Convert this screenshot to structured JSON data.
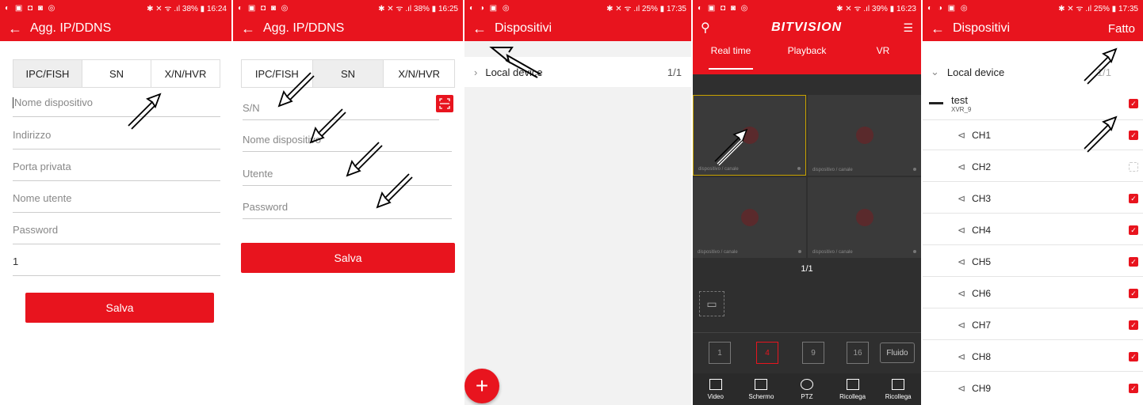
{
  "colors": {
    "accent": "#e8141e",
    "dark": "#333333"
  },
  "panel1": {
    "status_left": "◐ ▣ ◘ ◙ ◎",
    "status_right": "✱ ✕ ᯤ .ıl 38% ▮ 16:24",
    "title": "Agg. IP/DDNS",
    "tabs": [
      "IPC/FISH",
      "SN",
      "X/N/HVR"
    ],
    "fields": {
      "device_name": "Nome dispositivo",
      "address": "Indirizzo",
      "private_port": "Porta privata",
      "username": "Nome utente",
      "password": "Password",
      "channels_value": "1"
    },
    "save": "Salva"
  },
  "panel2": {
    "status_left": "◐ ▣ ◘ ◙ ◎",
    "status_right": "✱ ✕ ᯤ .ıl 38% ▮ 16:25",
    "title": "Agg. IP/DDNS",
    "tabs": [
      "IPC/FISH",
      "SN",
      "X/N/HVR"
    ],
    "fields": {
      "sn": "S/N",
      "device_name": "Nome dispositivo",
      "user": "Utente",
      "password": "Password"
    },
    "save": "Salva"
  },
  "panel3": {
    "status_left": "◐ ◑ ▣ ◎",
    "status_right": "✱ ✕ ᯤ .ıl 25% ▮ 17:35",
    "title": "Dispositivi",
    "row_label": "Local device",
    "row_count": "1/1",
    "fab": "+"
  },
  "panel4": {
    "status_left": "◐ ▣ ◘ ◙ ◎",
    "status_right": "✱ ✕ ᯤ .ıl 39% ▮ 16:23",
    "brand": "BITVISION",
    "tabs": [
      "Real time",
      "Playback",
      "VR"
    ],
    "cell_label": "dispositivo / canale",
    "page": "1/1",
    "modes": [
      "1",
      "4",
      "9",
      "16"
    ],
    "fluid": "Fluido",
    "nav": [
      "Video",
      "Schermo",
      "PTZ",
      "Ricollega",
      "Ricollega"
    ]
  },
  "panel5": {
    "status_left": "◐ ◑ ▣ ◎",
    "status_right": "✱ ✕ ᯤ .ıl 25% ▮ 17:35",
    "title": "Dispositivi",
    "action": "Fatto",
    "group": "Local device",
    "group_count": "1/1",
    "device_name": "test",
    "device_sub": "XVR_9",
    "channels": [
      {
        "name": "CH1",
        "checked": true
      },
      {
        "name": "CH2",
        "checked": false
      },
      {
        "name": "CH3",
        "checked": true
      },
      {
        "name": "CH4",
        "checked": true
      },
      {
        "name": "CH5",
        "checked": true
      },
      {
        "name": "CH6",
        "checked": true
      },
      {
        "name": "CH7",
        "checked": true
      },
      {
        "name": "CH8",
        "checked": true
      },
      {
        "name": "CH9",
        "checked": true
      }
    ]
  }
}
